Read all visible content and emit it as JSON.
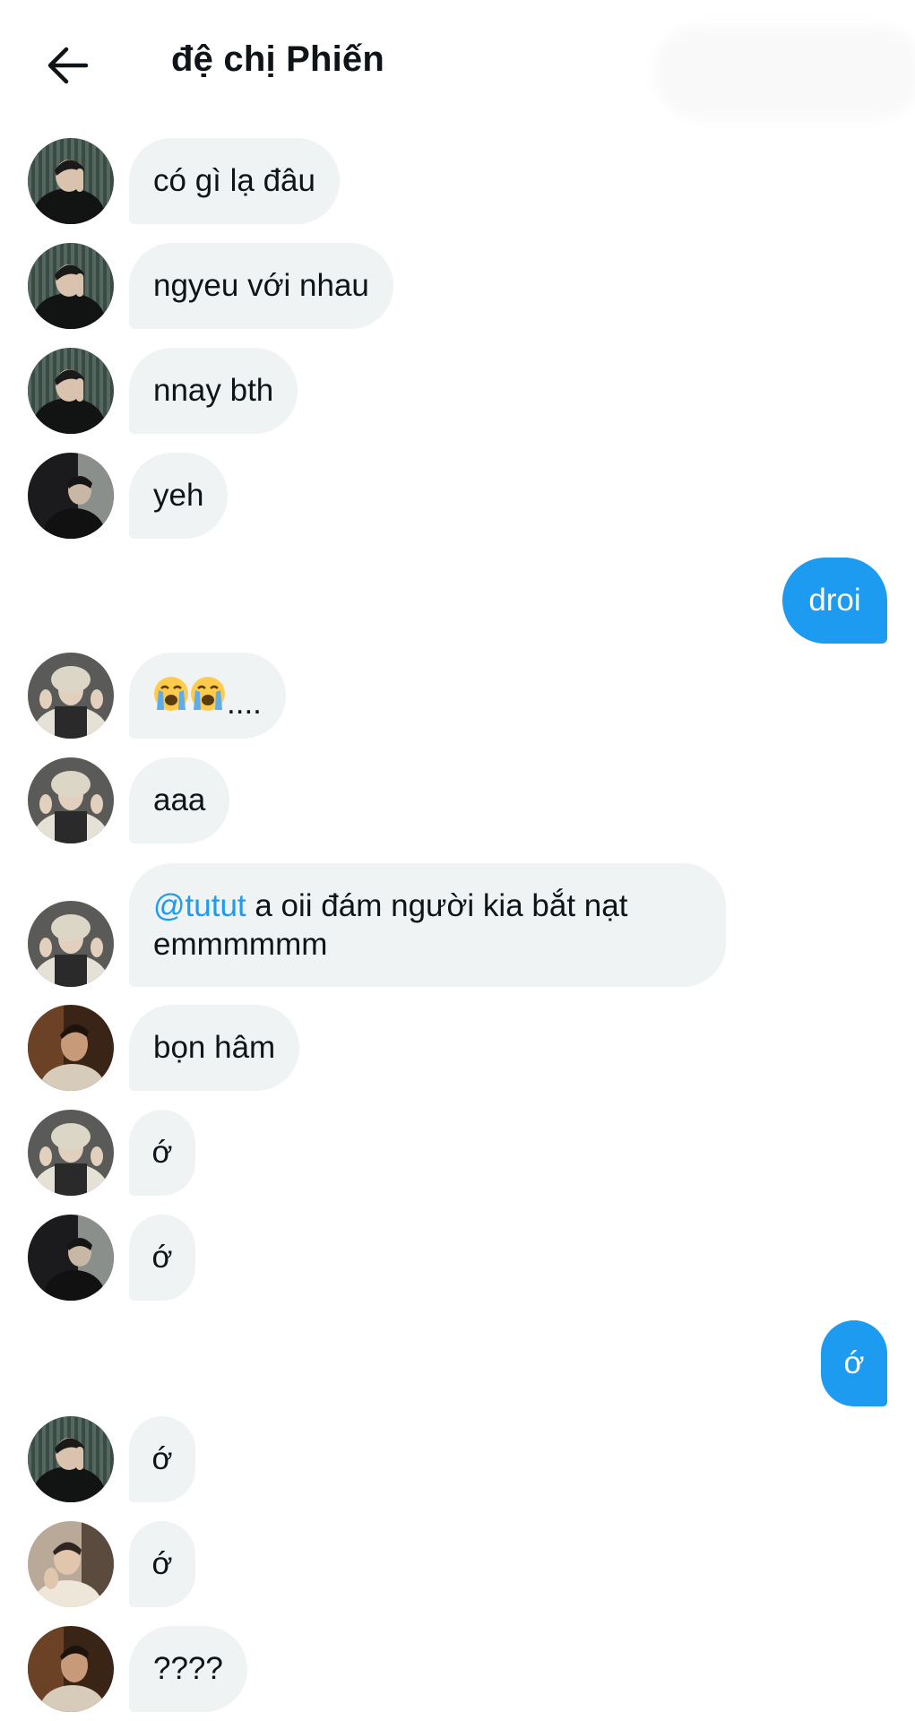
{
  "header": {
    "title": "đệ chị Phiến",
    "back_icon": "arrow-left-icon"
  },
  "colors": {
    "sent_bubble": "#1d9bf0",
    "received_bubble": "#eff3f4",
    "mention": "#1d9bf0",
    "text": "#0f1419"
  },
  "messages": [
    {
      "direction": "received",
      "avatar": "user-a",
      "text": "có gì lạ đâu"
    },
    {
      "direction": "received",
      "avatar": "user-a",
      "text": "ngyeu với nhau"
    },
    {
      "direction": "received",
      "avatar": "user-a",
      "text": "nnay bth"
    },
    {
      "direction": "received",
      "avatar": "user-b",
      "text": "yeh"
    },
    {
      "direction": "sent",
      "text": "droi"
    },
    {
      "direction": "received",
      "avatar": "user-c",
      "emoji": "loudly-crying-face x2",
      "text": "...."
    },
    {
      "direction": "received",
      "avatar": "user-c",
      "text": "aaa"
    },
    {
      "direction": "received",
      "avatar": "user-c",
      "mention": "@tutut",
      "text": " a oii đám người kia bắt nạt emmmmmm"
    },
    {
      "direction": "received",
      "avatar": "user-d",
      "text": "bọn hâm"
    },
    {
      "direction": "received",
      "avatar": "user-c",
      "text": "ớ"
    },
    {
      "direction": "received",
      "avatar": "user-b",
      "text": "ớ"
    },
    {
      "direction": "sent",
      "text": "ớ"
    },
    {
      "direction": "received",
      "avatar": "user-a",
      "text": "ớ"
    },
    {
      "direction": "received",
      "avatar": "user-e",
      "text": "ớ"
    },
    {
      "direction": "received",
      "avatar": "user-d",
      "text": "????"
    }
  ]
}
